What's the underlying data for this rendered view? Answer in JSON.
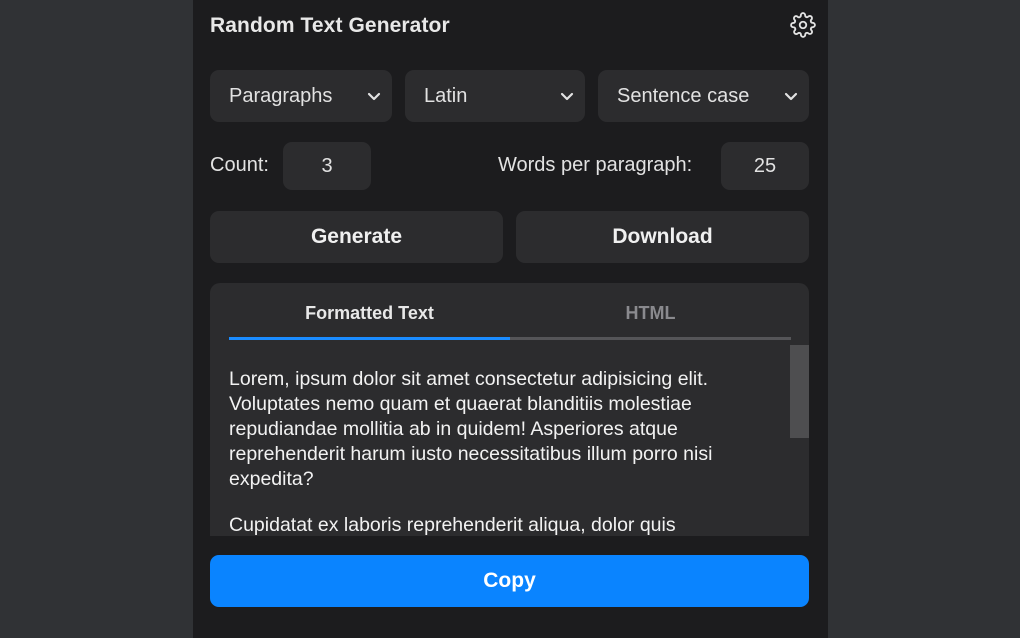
{
  "app": {
    "title": "Random Text Generator",
    "settings_icon": "gear-icon"
  },
  "options": {
    "type": "Paragraphs",
    "language": "Latin",
    "case": "Sentence case",
    "chevron_icon": "chevron-down-icon"
  },
  "count": {
    "label": "Count:",
    "value": "3"
  },
  "words": {
    "label": "Words per paragraph:",
    "value": "25"
  },
  "actions": {
    "generate": "Generate",
    "download": "Download",
    "copy": "Copy"
  },
  "tabs": [
    {
      "label": "Formatted Text",
      "active": true
    },
    {
      "label": "HTML",
      "active": false
    }
  ],
  "output": {
    "paragraphs": [
      "Lorem, ipsum dolor sit amet consectetur adipisicing elit. Voluptates nemo quam et quaerat blanditiis molestiae repudiandae mollitia ab in quidem! Asperiores atque reprehenderit harum iusto necessitatibus illum porro nisi expedita?",
      "Cupidatat ex laboris reprehenderit aliqua, dolor quis"
    ]
  },
  "colors": {
    "background": "#303235",
    "panel": "#1c1c1e",
    "control": "#2c2c2e",
    "accent": "#0a84ff",
    "tab_active": "#1a8cff",
    "text": "#e2e2e2",
    "muted": "#8a8a8e"
  }
}
